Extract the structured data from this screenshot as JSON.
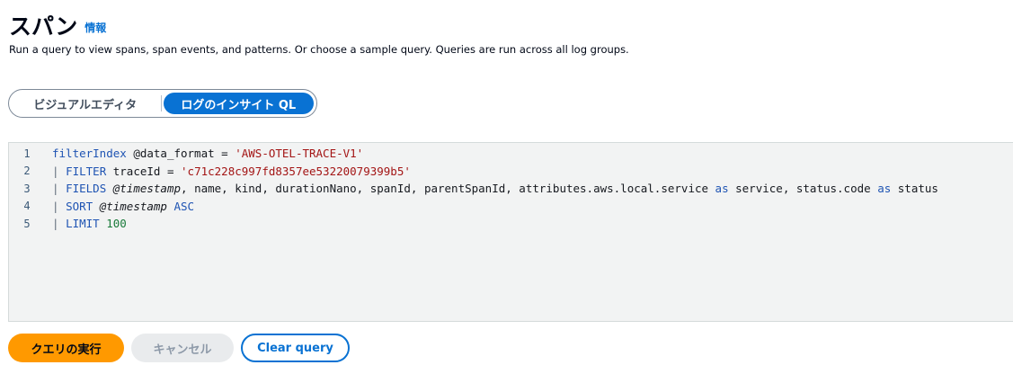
{
  "header": {
    "title": "スパン",
    "info_link": "情報",
    "description": "Run a query to view spans, span events, and patterns. Or choose a sample query. Queries are run across all log groups."
  },
  "mode_toggle": {
    "options": [
      "ビジュアルエディタ",
      "ログのインサイト QL"
    ],
    "selected": "ログのインサイト QL"
  },
  "editor": {
    "lines": [
      {
        "num": "1",
        "text": "filterIndex @data_format = 'AWS-OTEL-TRACE-V1'"
      },
      {
        "num": "2",
        "text": "| FILTER traceId = 'c71c228c997fd8357ee53220079399b5'"
      },
      {
        "num": "3",
        "text": "| FIELDS @timestamp, name, kind, durationNano, spanId, parentSpanId, attributes.aws.local.service as service, status.code as status"
      },
      {
        "num": "4",
        "text": "| SORT @timestamp ASC"
      },
      {
        "num": "5",
        "text": "| LIMIT 100"
      }
    ]
  },
  "actions": {
    "run": "クエリの実行",
    "cancel": "キャンセル",
    "clear": "Clear query"
  },
  "colors": {
    "primary": "#ff9900",
    "link": "#0972d3",
    "editor_bg": "#f2f3f3"
  }
}
